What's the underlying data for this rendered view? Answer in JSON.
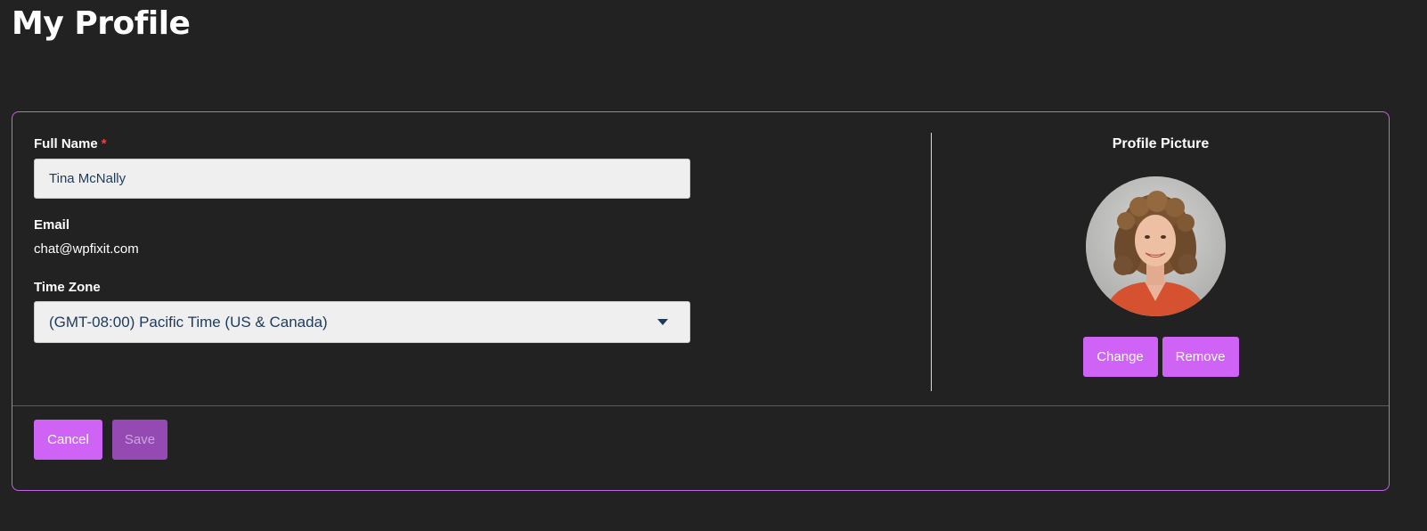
{
  "page": {
    "title": "My Profile"
  },
  "form": {
    "full_name_label": "Full Name",
    "required_marker": "*",
    "full_name_value": "Tina McNally",
    "email_label": "Email",
    "email_value": "chat@wpfixit.com",
    "timezone_label": "Time Zone",
    "timezone_value": "(GMT-08:00) Pacific Time (US & Canada)"
  },
  "profile_picture": {
    "heading": "Profile Picture",
    "change_label": "Change",
    "remove_label": "Remove"
  },
  "actions": {
    "cancel_label": "Cancel",
    "save_label": "Save"
  },
  "colors": {
    "accent": "#cf63f5",
    "accent_disabled": "#9549b3",
    "card_border": "#c065e6",
    "background": "#222222",
    "required": "#e04848"
  },
  "icons": {
    "timezone_dropdown": "caret-down-icon"
  }
}
